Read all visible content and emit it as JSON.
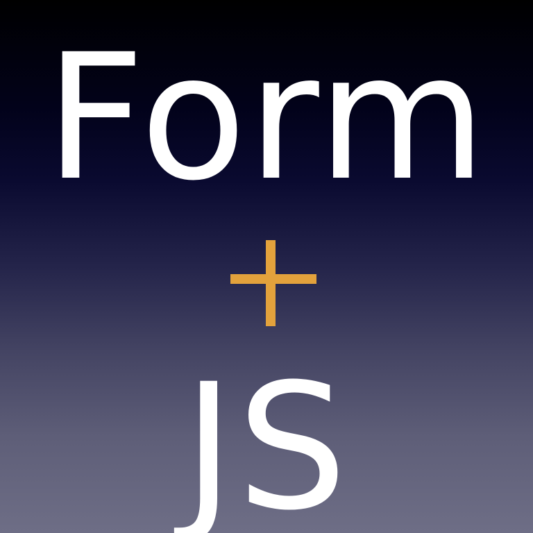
{
  "title": {
    "top_word": "Form",
    "bottom_word": "JS"
  },
  "plus_icon": {
    "icon": "plus-icon",
    "color": "#e3a23c"
  },
  "colors": {
    "text": "#ffffff",
    "background_top": "#000000",
    "background_bottom": "#6e6e86"
  }
}
